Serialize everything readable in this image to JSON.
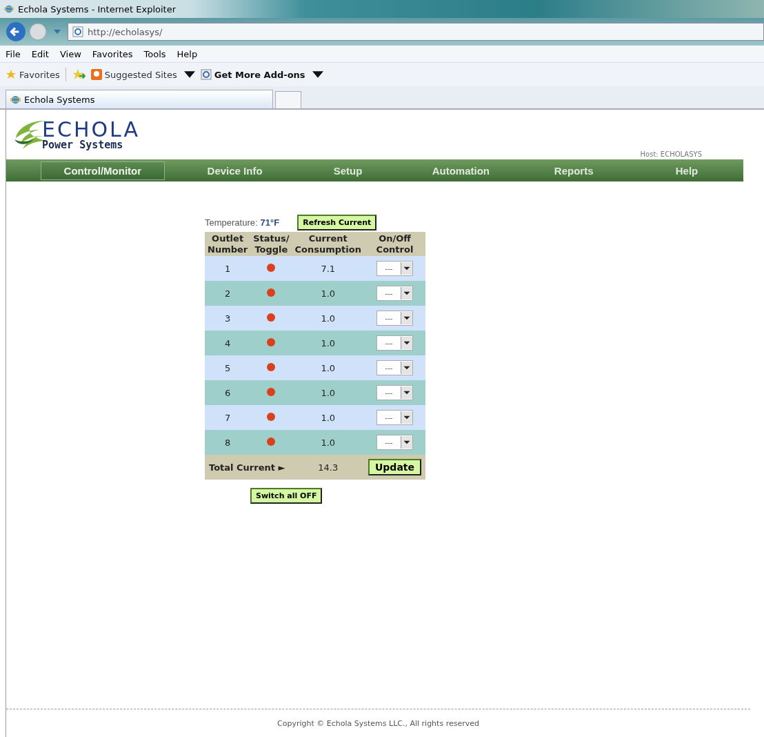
{
  "window": {
    "title": "Echola Systems - Internet Exploiter"
  },
  "address_bar": {
    "url": "http://echolasys/"
  },
  "menu": [
    "File",
    "Edit",
    "View",
    "Favorites",
    "Tools",
    "Help"
  ],
  "favorites_bar": [
    {
      "kind": "favorites",
      "label": "Favorites"
    },
    {
      "kind": "add"
    },
    {
      "kind": "suggested",
      "label": "Suggested Sites"
    },
    {
      "kind": "addons",
      "label": "Get More Add-ons"
    }
  ],
  "tabs": [
    {
      "label": "Echola Systems",
      "selected": true
    },
    {
      "kind": "new",
      "selected": false
    }
  ],
  "logo": {
    "name": "ECHOLA",
    "tagline": "Power Systems"
  },
  "host": "Host: ECHOLASYS",
  "nav": [
    {
      "label": "Control/Monitor",
      "selected": true
    },
    {
      "label": "Device Info",
      "selected": false
    },
    {
      "label": "Setup",
      "selected": false
    },
    {
      "label": "Automation",
      "selected": false
    },
    {
      "label": "Reports",
      "selected": false
    },
    {
      "label": "Help",
      "selected": false
    }
  ],
  "temperature": {
    "label": "Temperature:",
    "value": "71°F"
  },
  "refresh_button": "Refresh Current",
  "table": {
    "columns": [
      [
        "Outlet",
        "Number"
      ],
      [
        "Status/",
        "Toggle"
      ],
      [
        "Current",
        "Consumption"
      ],
      [
        "On/Off",
        "Control"
      ]
    ],
    "rows": [
      {
        "outlet": "1",
        "color": "#d9411e",
        "current": "7.1",
        "control": "---"
      },
      {
        "outlet": "2",
        "color": "#d9411e",
        "current": "1.0",
        "control": "---"
      },
      {
        "outlet": "3",
        "color": "#d9411e",
        "current": "1.0",
        "control": "---"
      },
      {
        "outlet": "4",
        "color": "#d9411e",
        "current": "1.0",
        "control": "---"
      },
      {
        "outlet": "5",
        "color": "#d9411e",
        "current": "1.0",
        "control": "---"
      },
      {
        "outlet": "6",
        "color": "#d9411e",
        "current": "1.0",
        "control": "---"
      },
      {
        "outlet": "7",
        "color": "#d9411e",
        "current": "1.0",
        "control": "---"
      },
      {
        "outlet": "8",
        "color": "#d9411e",
        "current": "1.0",
        "control": "---"
      }
    ],
    "total_label": "Total Current ►",
    "total": "14.3",
    "update_button": "Update"
  },
  "switch_all_off_button": "Switch all OFF",
  "footer": "Copyright © Echola Systems LLC., All rights reserved"
}
